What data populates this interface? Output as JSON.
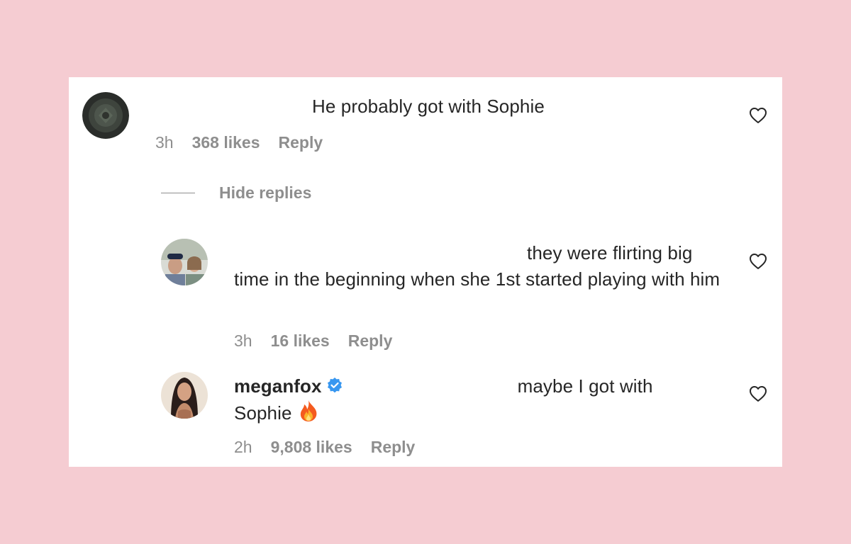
{
  "comments": [
    {
      "text": "He probably got with Sophie",
      "time": "3h",
      "likes": "368 likes",
      "reply_label": "Reply"
    }
  ],
  "hide_replies_label": "Hide replies",
  "replies": [
    {
      "text_line1": "they were flirting big",
      "text_rest": "time in the beginning when she 1st started playing with him",
      "time": "3h",
      "likes": "16 likes",
      "reply_label": "Reply"
    },
    {
      "username": "meganfox",
      "text_line1": "maybe I got with",
      "text_line2": "Sophie",
      "time": "2h",
      "likes": "9,808 likes",
      "reply_label": "Reply"
    }
  ],
  "icons": {
    "heart": "heart-outline-icon",
    "verified": "verified-badge-icon",
    "emoji": "fire-emoji-icon"
  },
  "colors": {
    "background": "#f5ccd2",
    "card": "#ffffff",
    "text": "#262626",
    "meta": "#8e8e8e",
    "verified": "#3897f0"
  }
}
